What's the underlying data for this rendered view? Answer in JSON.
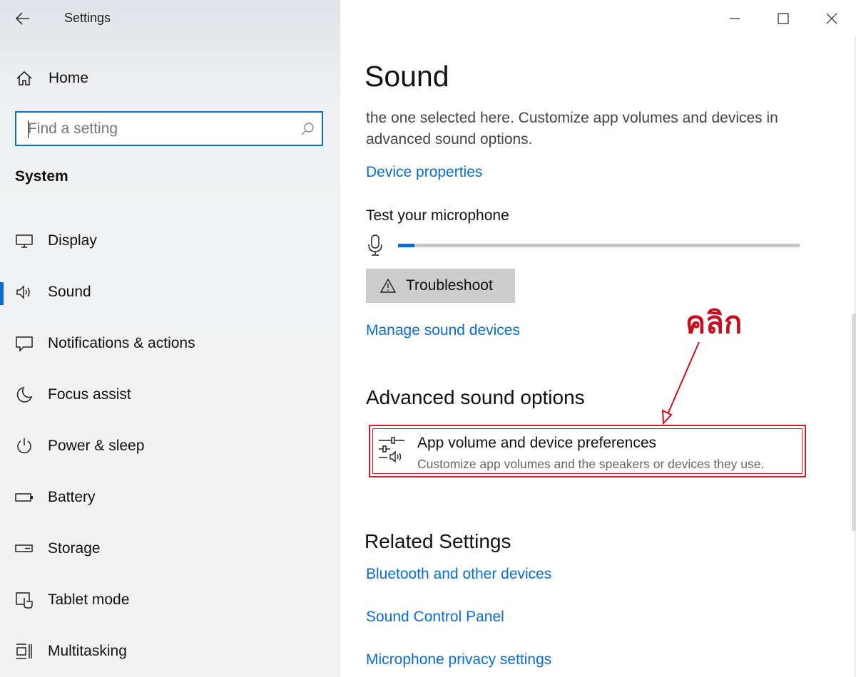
{
  "window": {
    "title": "Settings",
    "controls": [
      "minimize-icon",
      "maximize-icon",
      "close-icon"
    ]
  },
  "sidebar": {
    "home_label": "Home",
    "search_placeholder": "Find a setting",
    "section_label": "System",
    "items": [
      {
        "label": "Display",
        "icon": "display-icon",
        "active": false
      },
      {
        "label": "Sound",
        "icon": "speaker-icon",
        "active": true
      },
      {
        "label": "Notifications & actions",
        "icon": "notification-icon",
        "active": false
      },
      {
        "label": "Focus assist",
        "icon": "moon-icon",
        "active": false
      },
      {
        "label": "Power & sleep",
        "icon": "power-icon",
        "active": false
      },
      {
        "label": "Battery",
        "icon": "battery-icon",
        "active": false
      },
      {
        "label": "Storage",
        "icon": "storage-icon",
        "active": false
      },
      {
        "label": "Tablet mode",
        "icon": "tablet-icon",
        "active": false
      },
      {
        "label": "Multitasking",
        "icon": "multitasking-icon",
        "active": false
      }
    ]
  },
  "main": {
    "title": "Sound",
    "description": "the one selected here. Customize app volumes and devices in advanced sound options.",
    "device_properties_link": "Device properties",
    "mic_test_title": "Test your microphone",
    "mic_level": 0.04,
    "troubleshoot_label": "Troubleshoot",
    "manage_devices_link": "Manage sound devices",
    "advanced_title": "Advanced sound options",
    "app_pref_title": "App volume and device preferences",
    "app_pref_subtitle": "Customize app volumes and the speakers or devices they use.",
    "related_title": "Related Settings",
    "related_links": [
      "Bluetooth and other devices",
      "Sound Control Panel",
      "Microphone privacy settings"
    ]
  },
  "annotation": {
    "text": "คลิก",
    "color": "#c50f1f"
  },
  "colors": {
    "accent": "#0a6cd2",
    "highlight_box": "#d11a2a"
  }
}
